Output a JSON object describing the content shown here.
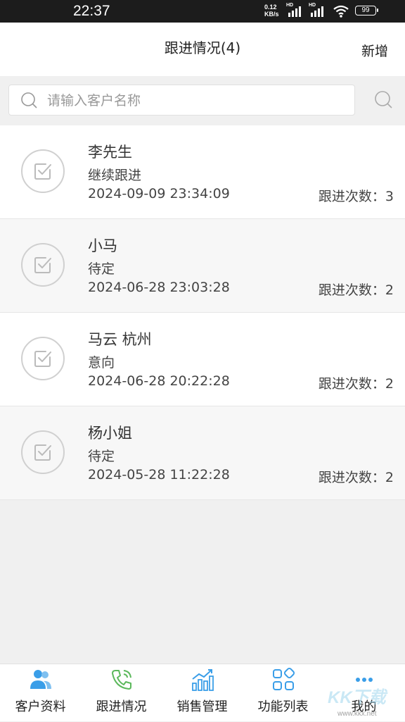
{
  "status_bar": {
    "time": "22:37",
    "net_speed_value": "0.12",
    "net_speed_unit": "KB/s",
    "hd_label_1": "HD",
    "hd_label_2": "HD",
    "battery": "99"
  },
  "header": {
    "title": "跟进情况(4)",
    "add_label": "新增"
  },
  "search": {
    "placeholder": "请输入客户名称",
    "value": ""
  },
  "items": [
    {
      "name": "李先生",
      "status": "继续跟进",
      "datetime": "2024-09-09 23:34:09",
      "count_label": "跟进次数：3"
    },
    {
      "name": "小马",
      "status": "待定",
      "datetime": "2024-06-28 23:03:28",
      "count_label": "跟进次数：2"
    },
    {
      "name": "马云 杭州",
      "status": "意向",
      "datetime": "2024-06-28 20:22:28",
      "count_label": "跟进次数：2"
    },
    {
      "name": "杨小姐",
      "status": "待定",
      "datetime": "2024-05-28 11:22:28",
      "count_label": "跟进次数：2"
    }
  ],
  "tabs": [
    {
      "label": "客户资料",
      "icon": "customers-icon"
    },
    {
      "label": "跟进情况",
      "icon": "phone-icon"
    },
    {
      "label": "销售管理",
      "icon": "chart-icon"
    },
    {
      "label": "功能列表",
      "icon": "grid-icon"
    },
    {
      "label": "我的",
      "icon": "more-icon"
    }
  ],
  "watermark": {
    "text": "KK下载",
    "url": "www.kkx.net"
  },
  "colors": {
    "accent_blue": "#3a9ee8",
    "accent_green": "#5cb85c",
    "avatar_border": "#d0d0d0"
  }
}
